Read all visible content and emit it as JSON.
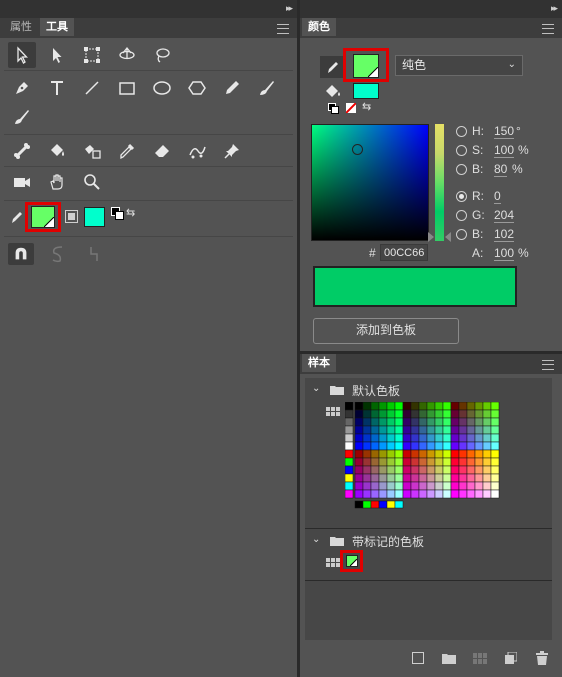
{
  "left_panel": {
    "tabs": [
      {
        "label": "属性",
        "active": false
      },
      {
        "label": "工具",
        "active": true
      }
    ],
    "tool_rows": [
      [
        "selection-arrow",
        "subselection-arrow",
        "free-transform",
        "3d-rotation",
        "lasso"
      ],
      [
        "pen",
        "text",
        "line",
        "rectangle",
        "oval",
        "polystar",
        "pencil",
        "paint-brush"
      ],
      [
        "brush"
      ],
      [
        "bone",
        "paint-bucket",
        "ink-bottle",
        "eyedropper",
        "eraser",
        "asset-warp",
        "pin"
      ],
      [
        "camera",
        "hand",
        "zoom"
      ]
    ],
    "stroke_color": "#66FF66",
    "fill_color": "#00FFCC",
    "options": [
      "snap-to-objects",
      "smooth",
      "straighten"
    ]
  },
  "color_panel": {
    "tab": "颜色",
    "type_select": "纯色",
    "stroke_color": "#66FF66",
    "fill_color": "#00FFCC",
    "current_color": "#00CC66",
    "hsb": {
      "h": {
        "label": "H:",
        "value": "150",
        "unit": "°"
      },
      "s": {
        "label": "S:",
        "value": "100",
        "unit": "%"
      },
      "b": {
        "label": "B:",
        "value": "80",
        "unit": "%"
      }
    },
    "rgb": {
      "r": {
        "label": "R:",
        "value": "0"
      },
      "g": {
        "label": "G:",
        "value": "204"
      },
      "b": {
        "label": "B:",
        "value": "102"
      }
    },
    "alpha": {
      "label": "A:",
      "value": "100",
      "unit": "%"
    },
    "hex_prefix": "#",
    "hex_value": "00CC66",
    "add_button": "添加到色板",
    "selected_mode": "R"
  },
  "swatches_panel": {
    "tab": "样本",
    "groups": [
      {
        "name": "默认色板"
      },
      {
        "name": "带标记的色板"
      }
    ],
    "tagged_swatch": "#66FF66"
  }
}
